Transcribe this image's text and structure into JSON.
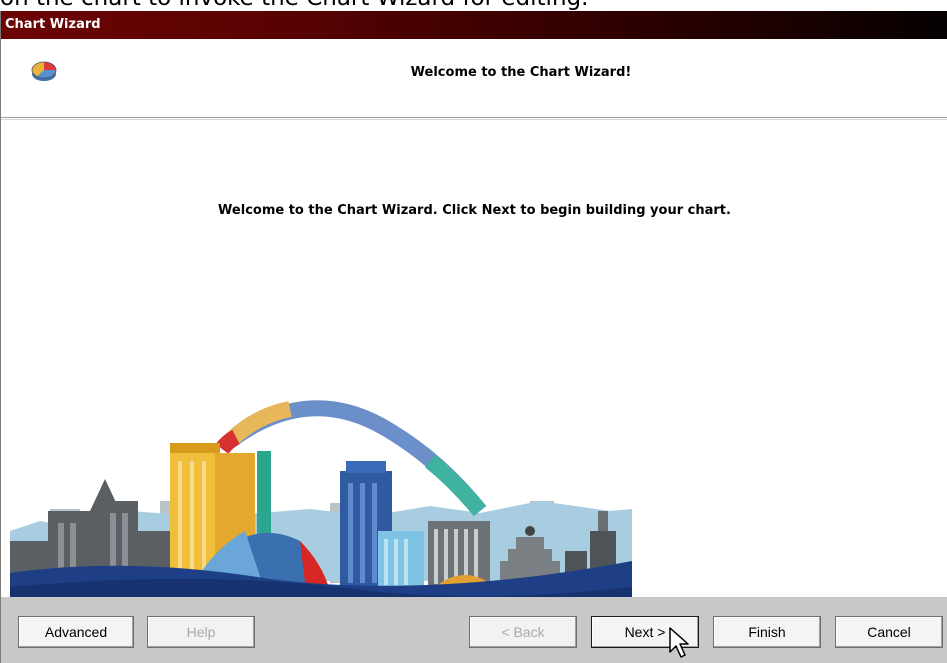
{
  "caption": "on the chart to invoke the Chart Wizard for editing.",
  "window": {
    "title": "Chart Wizard"
  },
  "header": {
    "icon": "pie-chart-icon",
    "title": "Welcome to the Chart Wizard!"
  },
  "content": {
    "message": "Welcome to the Chart Wizard.  Click Next to begin building your chart.",
    "illustration": "city-skyline-chart-illustration"
  },
  "buttons": {
    "advanced": "Advanced",
    "help": "Help",
    "back": "< Back",
    "next": "Next >",
    "finish": "Finish",
    "cancel": "Cancel"
  },
  "button_state": {
    "help_enabled": false,
    "back_enabled": false
  },
  "colors": {
    "titlebar_start": "#6d0404",
    "titlebar_end": "#050000",
    "button_bar": "#c8c8c8"
  }
}
